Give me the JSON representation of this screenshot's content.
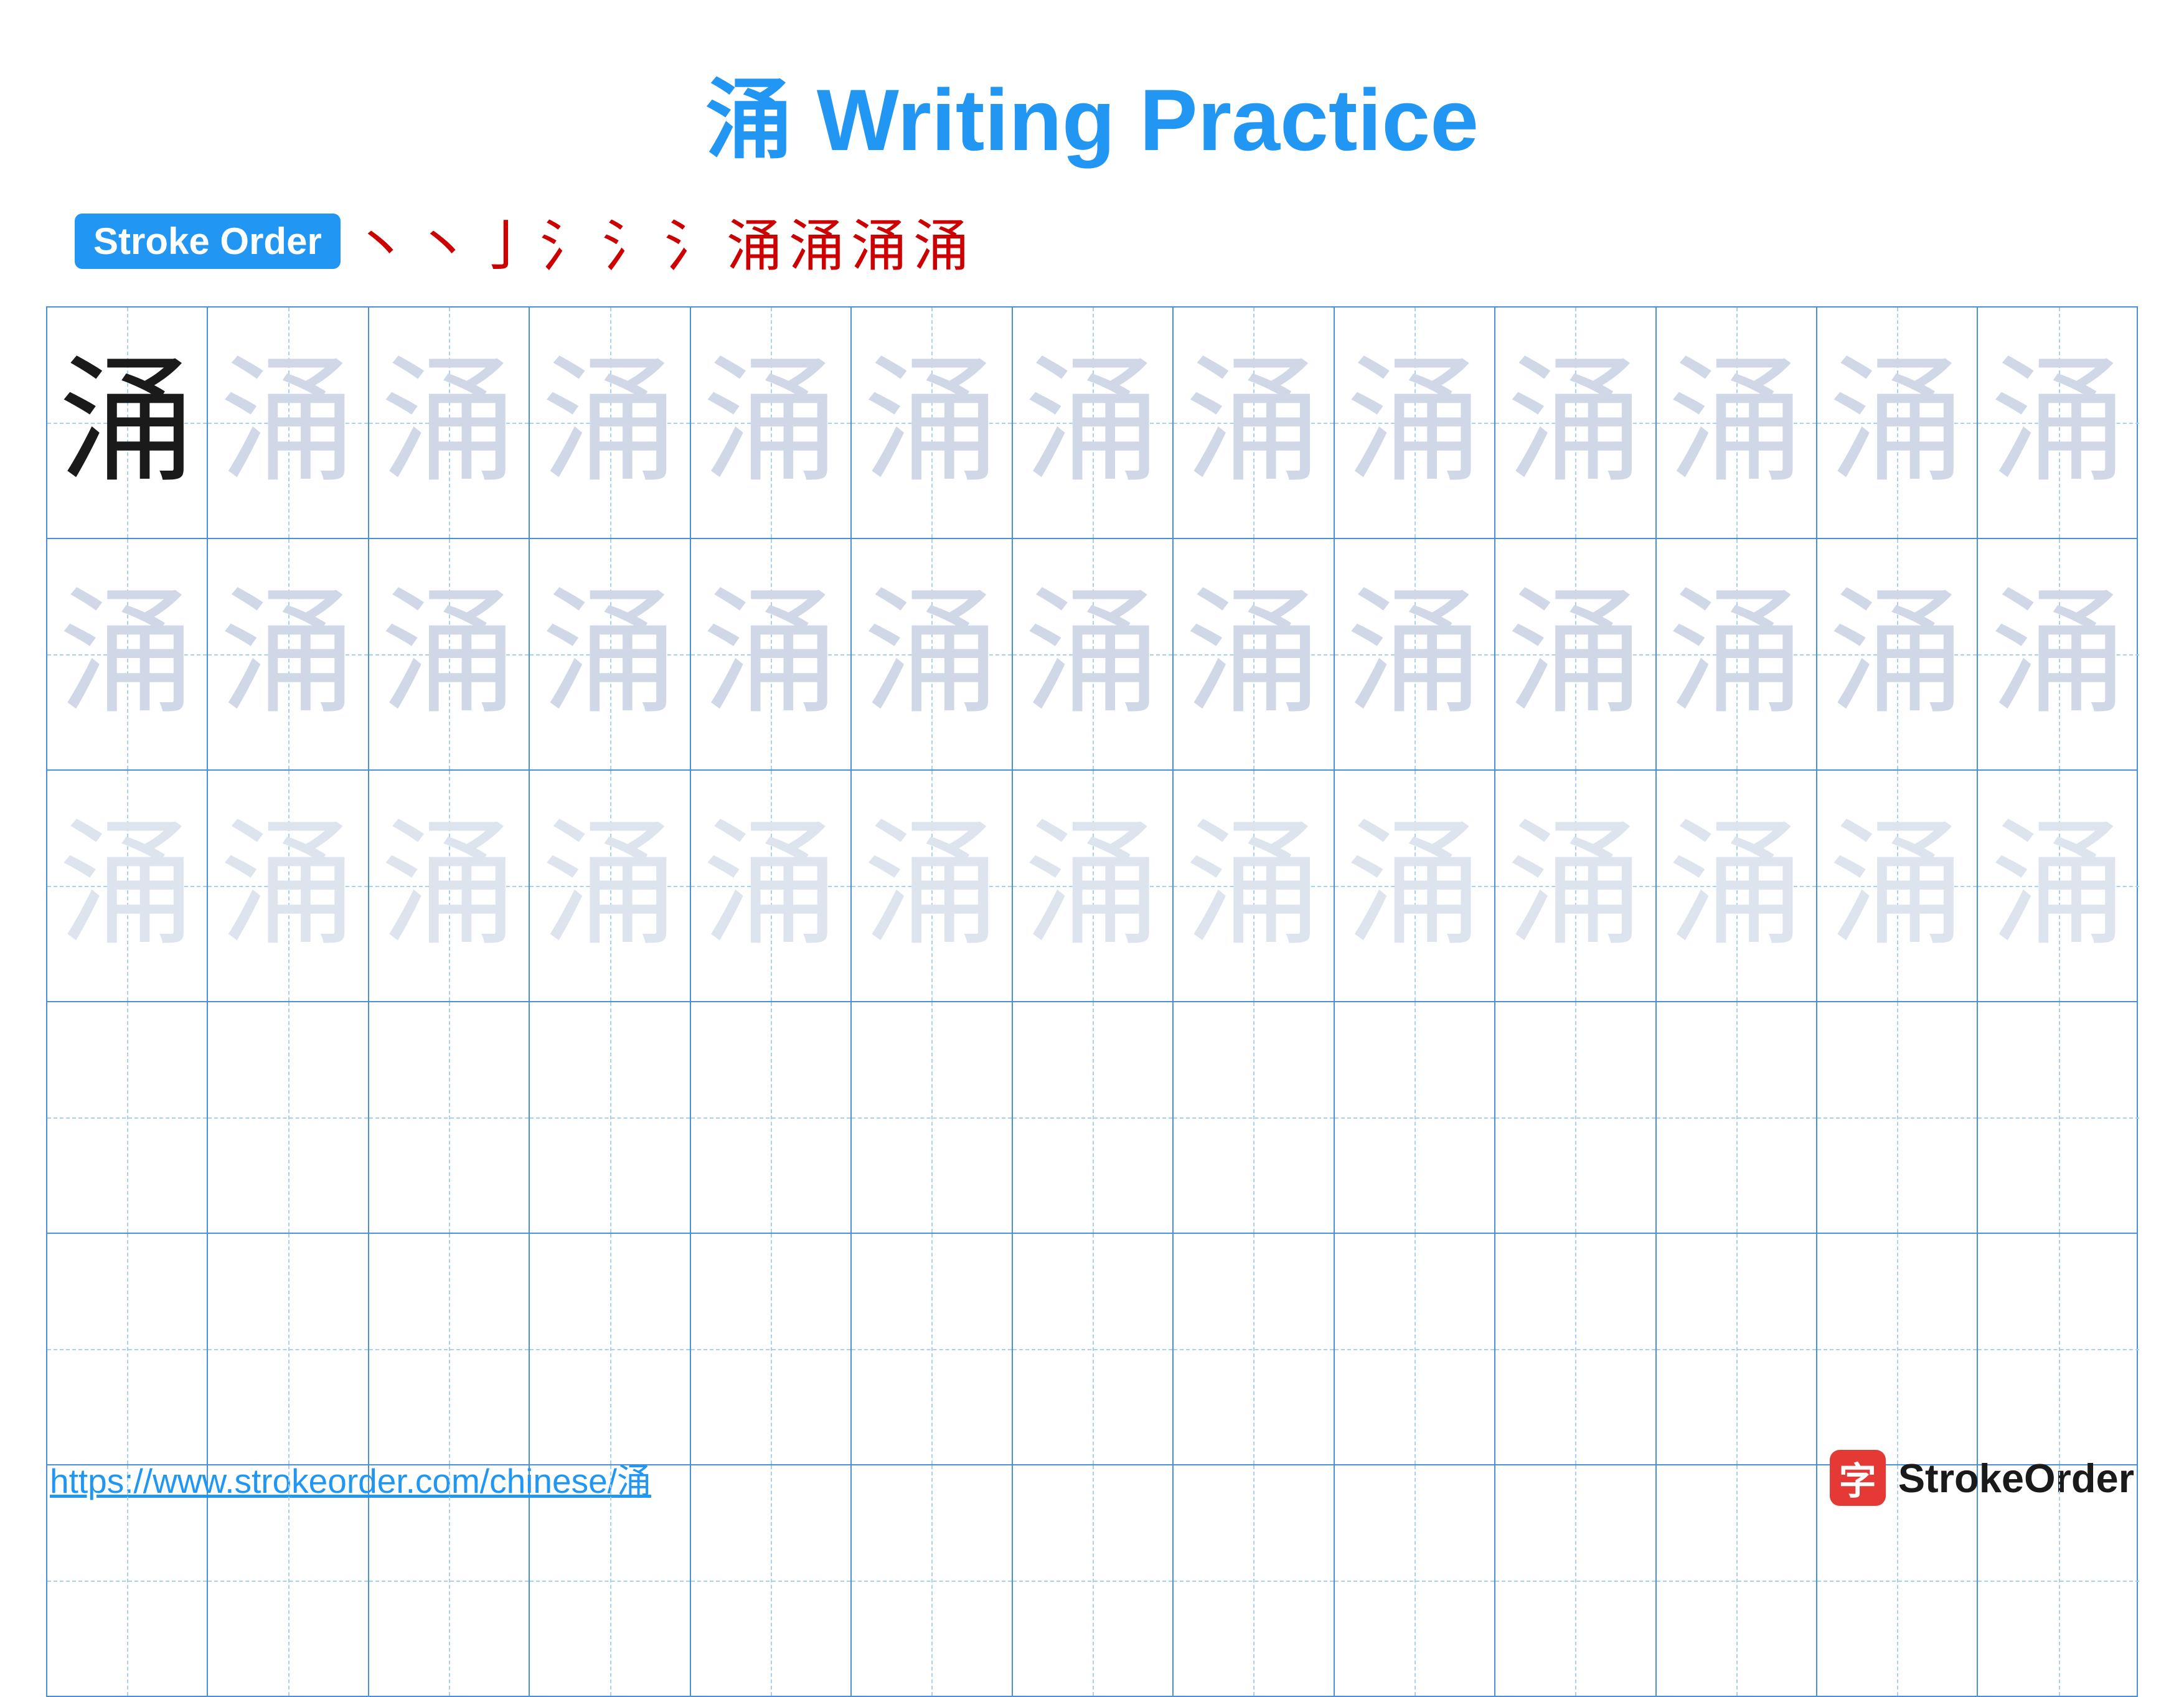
{
  "title": "涌 Writing Practice",
  "stroke_order_label": "Stroke Order",
  "stroke_sequence": [
    "丶",
    "丶",
    "亅",
    "氵",
    "氵",
    "氵",
    "涌",
    "涌",
    "涌",
    "涌"
  ],
  "character": "涌",
  "footer_url": "https://www.strokeorder.com/chinese/涌",
  "footer_brand": "StrokeOrder",
  "footer_brand_char": "字",
  "grid": {
    "rows": 6,
    "cols": 13
  },
  "colors": {
    "primary": "#2196F3",
    "dark_char": "#1a1a1a",
    "light1": "#c8d4e8",
    "light2": "#d8e0ee",
    "light3": "#e4eaf4",
    "grid_border": "#4a90d9",
    "grid_dash": "#a8d0f0"
  }
}
